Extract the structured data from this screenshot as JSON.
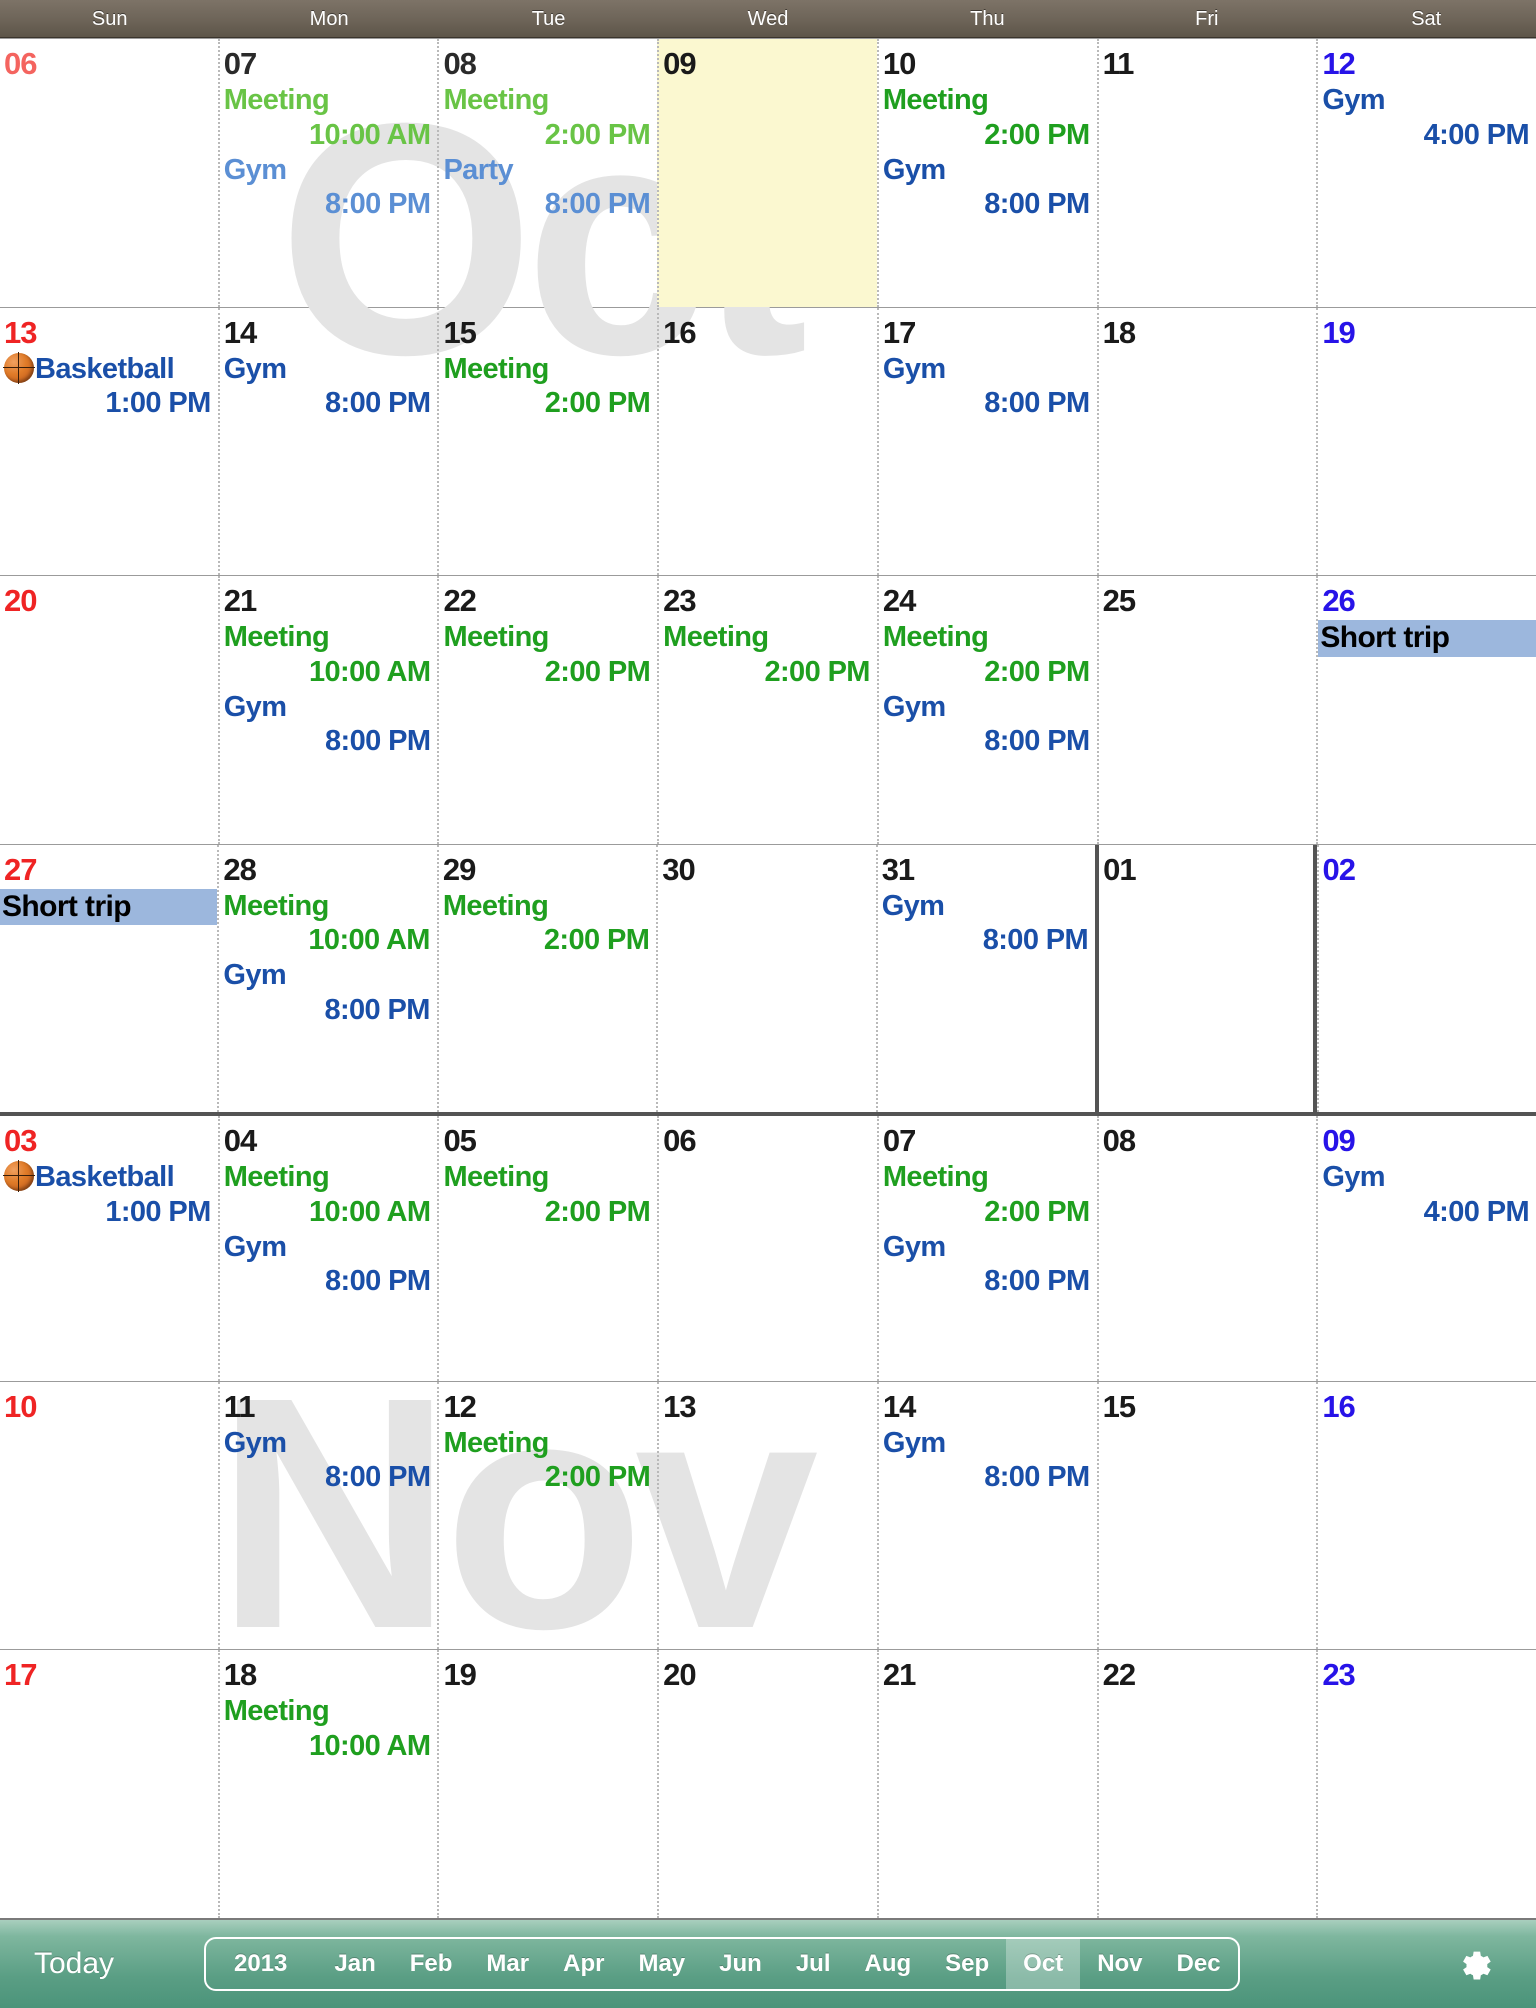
{
  "header": {
    "weekdays": [
      "Sun",
      "Mon",
      "Tue",
      "Wed",
      "Thu",
      "Fri",
      "Sat"
    ]
  },
  "watermarks": {
    "oct": "Oct",
    "nov": "Nov"
  },
  "colors": {
    "header_bar": "#6d6458",
    "toolbar": "#5a9e84",
    "sunday": "#ef2424",
    "saturday": "#2713e8",
    "meeting_green": "#1f9f1f",
    "gym_blue": "#1a4fa8",
    "allday_band": "#9cb7dd",
    "today_cell": "#fbf8d0",
    "month_border": "#545454"
  },
  "weeks": [
    {
      "thick_top": false,
      "days": [
        {
          "num": "06",
          "kind": "sun-dim",
          "events": []
        },
        {
          "num": "07",
          "kind": "dim",
          "events": [
            {
              "title": "Meeting",
              "time": "10:00 AM",
              "color": "c-green-dim"
            },
            {
              "title": "Gym",
              "time": "8:00 PM",
              "color": "c-blue-dim"
            }
          ]
        },
        {
          "num": "08",
          "kind": "dim",
          "events": [
            {
              "title": "Meeting",
              "time": "2:00 PM",
              "color": "c-green-dim"
            },
            {
              "title": "Party",
              "time": "8:00 PM",
              "color": "c-blue-dim"
            }
          ]
        },
        {
          "num": "09",
          "kind": "normal",
          "today": true,
          "events": []
        },
        {
          "num": "10",
          "kind": "normal",
          "events": [
            {
              "title": "Meeting",
              "time": "2:00 PM",
              "color": "c-green"
            },
            {
              "title": "Gym",
              "time": "8:00 PM",
              "color": "c-blue"
            }
          ]
        },
        {
          "num": "11",
          "kind": "normal",
          "events": []
        },
        {
          "num": "12",
          "kind": "sat",
          "events": [
            {
              "title": "Gym",
              "time": "4:00 PM",
              "color": "c-blue"
            }
          ]
        }
      ]
    },
    {
      "thick_top": false,
      "days": [
        {
          "num": "13",
          "kind": "sun",
          "events": [
            {
              "title": "Basketball",
              "time": "1:00 PM",
              "color": "c-blue",
              "icon": "basketball-icon"
            }
          ]
        },
        {
          "num": "14",
          "kind": "normal",
          "events": [
            {
              "title": "Gym",
              "time": "8:00 PM",
              "color": "c-blue"
            }
          ]
        },
        {
          "num": "15",
          "kind": "normal",
          "events": [
            {
              "title": "Meeting",
              "time": "2:00 PM",
              "color": "c-green"
            }
          ]
        },
        {
          "num": "16",
          "kind": "normal",
          "events": []
        },
        {
          "num": "17",
          "kind": "normal",
          "events": [
            {
              "title": "Gym",
              "time": "8:00 PM",
              "color": "c-blue"
            }
          ]
        },
        {
          "num": "18",
          "kind": "normal",
          "events": []
        },
        {
          "num": "19",
          "kind": "sat",
          "events": []
        }
      ]
    },
    {
      "thick_top": false,
      "days": [
        {
          "num": "20",
          "kind": "sun",
          "events": []
        },
        {
          "num": "21",
          "kind": "normal",
          "events": [
            {
              "title": "Meeting",
              "time": "10:00 AM",
              "color": "c-green"
            },
            {
              "title": "Gym",
              "time": "8:00 PM",
              "color": "c-blue"
            }
          ]
        },
        {
          "num": "22",
          "kind": "normal",
          "events": [
            {
              "title": "Meeting",
              "time": "2:00 PM",
              "color": "c-green"
            }
          ]
        },
        {
          "num": "23",
          "kind": "normal",
          "events": [
            {
              "title": "Meeting",
              "time": "2:00 PM",
              "color": "c-green"
            }
          ]
        },
        {
          "num": "24",
          "kind": "normal",
          "events": [
            {
              "title": "Meeting",
              "time": "2:00 PM",
              "color": "c-green"
            },
            {
              "title": "Gym",
              "time": "8:00 PM",
              "color": "c-blue"
            }
          ]
        },
        {
          "num": "25",
          "kind": "normal",
          "events": []
        },
        {
          "num": "26",
          "kind": "sat",
          "events": [
            {
              "title": "Short trip",
              "allday": true
            }
          ]
        }
      ]
    },
    {
      "thick_top": false,
      "days": [
        {
          "num": "27",
          "kind": "sun",
          "events": [
            {
              "title": "Short trip",
              "allday": true
            }
          ]
        },
        {
          "num": "28",
          "kind": "normal",
          "events": [
            {
              "title": "Meeting",
              "time": "10:00 AM",
              "color": "c-green"
            },
            {
              "title": "Gym",
              "time": "8:00 PM",
              "color": "c-blue"
            }
          ]
        },
        {
          "num": "29",
          "kind": "normal",
          "events": [
            {
              "title": "Meeting",
              "time": "2:00 PM",
              "color": "c-green"
            }
          ]
        },
        {
          "num": "30",
          "kind": "normal",
          "events": []
        },
        {
          "num": "31",
          "kind": "normal",
          "events": [
            {
              "title": "Gym",
              "time": "8:00 PM",
              "color": "c-blue"
            }
          ]
        },
        {
          "num": "01",
          "kind": "normal",
          "month_start": true,
          "events": []
        },
        {
          "num": "02",
          "kind": "sat",
          "events": []
        }
      ]
    },
    {
      "thick_top": true,
      "days": [
        {
          "num": "03",
          "kind": "sun",
          "events": [
            {
              "title": "Basketball",
              "time": "1:00 PM",
              "color": "c-blue",
              "icon": "basketball-icon"
            }
          ]
        },
        {
          "num": "04",
          "kind": "normal",
          "events": [
            {
              "title": "Meeting",
              "time": "10:00 AM",
              "color": "c-green"
            },
            {
              "title": "Gym",
              "time": "8:00 PM",
              "color": "c-blue"
            }
          ]
        },
        {
          "num": "05",
          "kind": "normal",
          "events": [
            {
              "title": "Meeting",
              "time": "2:00 PM",
              "color": "c-green"
            }
          ]
        },
        {
          "num": "06",
          "kind": "normal",
          "events": []
        },
        {
          "num": "07",
          "kind": "normal",
          "events": [
            {
              "title": "Meeting",
              "time": "2:00 PM",
              "color": "c-green"
            },
            {
              "title": "Gym",
              "time": "8:00 PM",
              "color": "c-blue"
            }
          ]
        },
        {
          "num": "08",
          "kind": "normal",
          "events": []
        },
        {
          "num": "09",
          "kind": "sat",
          "events": [
            {
              "title": "Gym",
              "time": "4:00 PM",
              "color": "c-blue"
            }
          ]
        }
      ]
    },
    {
      "thick_top": false,
      "days": [
        {
          "num": "10",
          "kind": "sun",
          "events": []
        },
        {
          "num": "11",
          "kind": "normal",
          "events": [
            {
              "title": "Gym",
              "time": "8:00 PM",
              "color": "c-blue"
            }
          ]
        },
        {
          "num": "12",
          "kind": "normal",
          "events": [
            {
              "title": "Meeting",
              "time": "2:00 PM",
              "color": "c-green"
            }
          ]
        },
        {
          "num": "13",
          "kind": "normal",
          "events": []
        },
        {
          "num": "14",
          "kind": "normal",
          "events": [
            {
              "title": "Gym",
              "time": "8:00 PM",
              "color": "c-blue"
            }
          ]
        },
        {
          "num": "15",
          "kind": "normal",
          "events": []
        },
        {
          "num": "16",
          "kind": "sat",
          "events": []
        }
      ]
    },
    {
      "thick_top": false,
      "days": [
        {
          "num": "17",
          "kind": "sun",
          "events": []
        },
        {
          "num": "18",
          "kind": "normal",
          "events": [
            {
              "title": "Meeting",
              "time": "10:00 AM",
              "color": "c-green"
            }
          ]
        },
        {
          "num": "19",
          "kind": "normal",
          "events": []
        },
        {
          "num": "20",
          "kind": "normal",
          "events": []
        },
        {
          "num": "21",
          "kind": "normal",
          "events": []
        },
        {
          "num": "22",
          "kind": "normal",
          "events": []
        },
        {
          "num": "23",
          "kind": "sat",
          "events": []
        }
      ]
    }
  ],
  "toolbar": {
    "today_label": "Today",
    "year_label": "2013",
    "months": [
      "Jan",
      "Feb",
      "Mar",
      "Apr",
      "May",
      "Jun",
      "Jul",
      "Aug",
      "Sep",
      "Oct",
      "Nov",
      "Dec"
    ],
    "selected_month": "Oct",
    "gear_icon": "gear-icon"
  }
}
